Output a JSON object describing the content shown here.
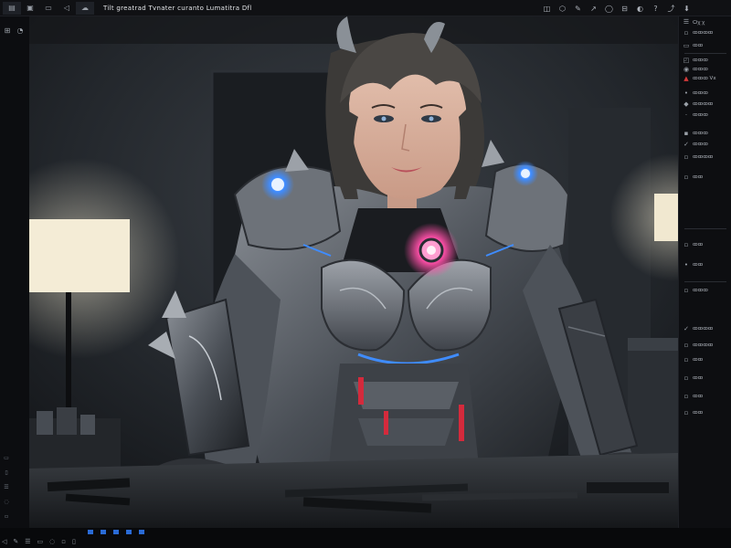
{
  "app": {
    "title": "Tilt greatrad Tvnater curanto Lumatitra Dfl"
  },
  "top_toolbar": {
    "left_icons": [
      "folder-icon",
      "image-icon",
      "monitor-icon",
      "arrow-icon",
      "cloud-icon"
    ],
    "right_icons": [
      "cube-icon",
      "hexagon-icon",
      "brush-icon",
      "arrow-icon",
      "circle-icon",
      "slider-icon",
      "paint-icon",
      "help-icon",
      "share-icon",
      "download-icon"
    ]
  },
  "left_toolbar": {
    "tools": [
      "grid-icon",
      "cursor-icon",
      "crop-icon",
      "tag-icon"
    ]
  },
  "right_panel": {
    "items": [
      {
        "icon": "layers-icon",
        "label": "Ѻꭓ ꭓ"
      },
      {
        "icon": "square-icon",
        "label": "ꝏꝏꝏꝏ"
      },
      {
        "icon": "folder-icon",
        "label": "ꝏꝏ"
      },
      {
        "icon": "lock-icon",
        "label": "ꝏꝏꝏ"
      },
      {
        "icon": "eye-icon",
        "label": "ꝏꝏꝏ"
      },
      {
        "icon": "flag-icon",
        "label": "ꝏꝏꝏ Vx"
      },
      {
        "icon": "bullet-icon",
        "label": "ꝏꝏꝏ"
      },
      {
        "icon": "diamond-icon",
        "label": "ꝏꝏꝏꝏ"
      },
      {
        "icon": "dot-icon",
        "label": "ꝏꝏꝏ"
      },
      {
        "icon": "square-icon",
        "label": "ꝏꝏꝏ"
      },
      {
        "icon": "tick-icon",
        "label": "ꝏꝏꝏ"
      },
      {
        "icon": "square-icon",
        "label": "ꝏꝏꝏꝏ"
      },
      {
        "icon": "square-icon",
        "label": "ꝏꝏ"
      },
      {
        "icon": "square-icon",
        "label": "ꝏꝏ"
      },
      {
        "icon": "bullet-icon",
        "label": "ꝏꝏ"
      },
      {
        "icon": "square-icon",
        "label": "ꝏꝏꝏ"
      },
      {
        "icon": "tick-icon",
        "label": "ꝏꝏꝏꝏ"
      },
      {
        "icon": "square-icon",
        "label": "ꝏꝏꝏꝏ"
      },
      {
        "icon": "square-icon",
        "label": "ꝏꝏ"
      },
      {
        "icon": "square-icon",
        "label": "ꝏꝏ"
      },
      {
        "icon": "square-icon",
        "label": "ꝏꝏ"
      },
      {
        "icon": "square-icon",
        "label": "ꝏꝏ"
      }
    ]
  },
  "bottom_bar": {
    "icons": [
      "cursor-icon",
      "brush-icon",
      "layers-icon",
      "crop-icon",
      "zoom-icon",
      "eraser-icon",
      "tag-icon"
    ]
  },
  "colors": {
    "accent": "#2a6bd6",
    "core_glow": "#ff4fa8",
    "arc_glow": "#3f8cff"
  }
}
